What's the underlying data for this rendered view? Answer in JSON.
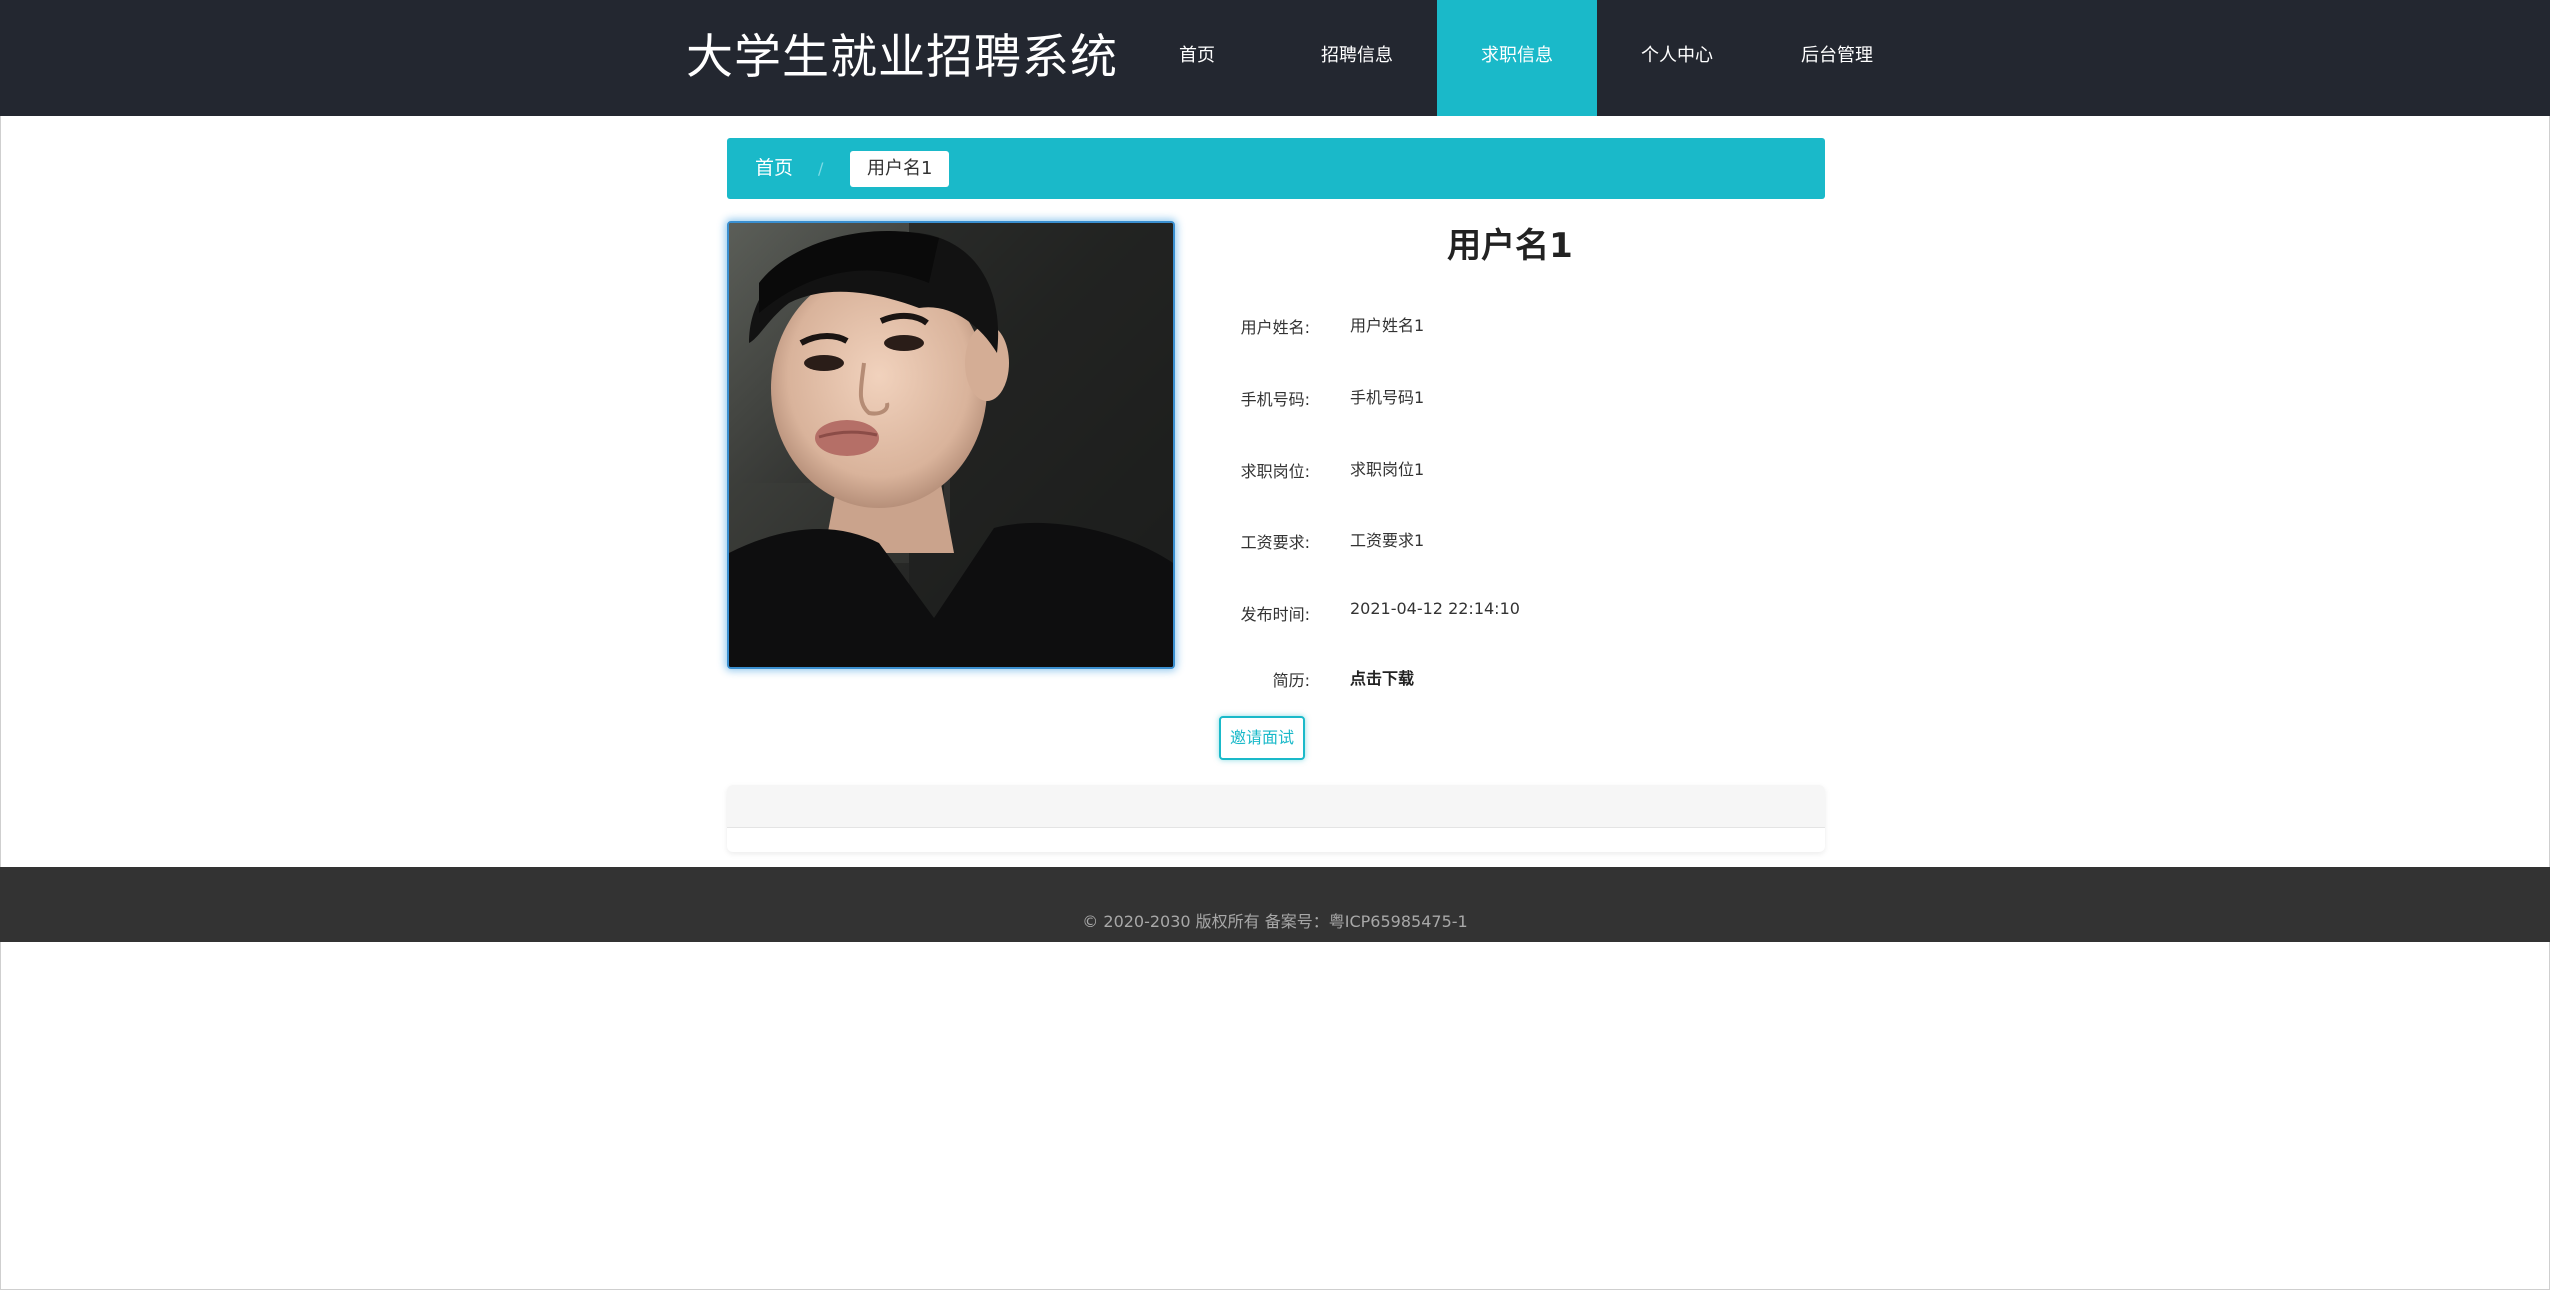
{
  "header": {
    "title": "大学生就业招聘系统",
    "nav": [
      "首页",
      "招聘信息",
      "求职信息",
      "个人中心",
      "后台管理"
    ],
    "active_index": 2
  },
  "breadcrumb": {
    "home": "首页",
    "separator": "/",
    "current": "用户名1"
  },
  "detail": {
    "name": "用户名1",
    "fields": [
      {
        "label": "用户姓名:",
        "value": "用户姓名1"
      },
      {
        "label": "手机号码:",
        "value": "手机号码1"
      },
      {
        "label": "求职岗位:",
        "value": "求职岗位1"
      },
      {
        "label": "工资要求:",
        "value": "工资要求1"
      },
      {
        "label": "发布时间:",
        "value": "2021-04-12 22:14:10"
      }
    ],
    "resume_label": "简历:",
    "resume_link": "点击下载",
    "invite_button": "邀请面试"
  },
  "footer": {
    "text": "© 2020-2030 版权所有 备案号：粤ICP65985475-1"
  },
  "colors": {
    "header_bg": "#232730",
    "accent": "#1ab9c9",
    "footer_bg": "#333333"
  },
  "icons": {
    "photo": "user-portrait-photo"
  }
}
